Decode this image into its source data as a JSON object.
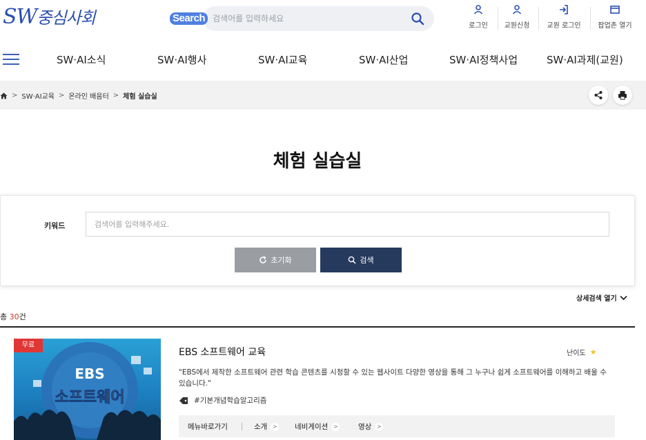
{
  "header": {
    "logo_sw": "SW",
    "logo_text": "중심사회",
    "search_tag": "Search",
    "search_placeholder": "검색어를 입력하세요",
    "utils": [
      {
        "label": "로그인",
        "icon": "person-icon"
      },
      {
        "label": "교원신청",
        "icon": "person-icon"
      },
      {
        "label": "교원 로그인",
        "icon": "login-icon"
      },
      {
        "label": "팝업존 열기",
        "icon": "window-icon"
      }
    ]
  },
  "nav": {
    "items": [
      "SW·AI소식",
      "SW·AI행사",
      "SW·AI교육",
      "SW·AI산업",
      "SW·AI정책사업",
      "SW·AI과제(교원)"
    ]
  },
  "breadcrumb": {
    "items": [
      "SW·AI교육",
      "온라인 배움터"
    ],
    "current": "체험 실습실"
  },
  "page": {
    "title": "체험 실습실"
  },
  "search_panel": {
    "keyword_label": "키워드",
    "keyword_placeholder": "검색어를 입력해주세요.",
    "reset_label": "초기화",
    "search_label": "검색",
    "detail_toggle": "상세검색 열기"
  },
  "results": {
    "total_prefix": "총 ",
    "total_count": "30",
    "total_suffix": "건"
  },
  "card": {
    "badge": "무료",
    "thumb_line1": "EBS",
    "thumb_line2": "소프트웨어",
    "title": "EBS 소프트웨어 교육",
    "difficulty_label": "난이도",
    "difficulty_stars": 1,
    "description": "\"EBS에서 제작한 소프트웨어 관련 학습 콘텐츠를 시청할 수 있는 웹사이트 다양한 영상을 통해 그 누구나 쉽게 소프트웨어를 이해하고 배울 수 있습니다.\"",
    "tag": "#기본개념학습알고리즘",
    "menu_label": "메뉴바로가기",
    "menu_items": [
      "소개",
      "네비게이션",
      "영상"
    ]
  },
  "colors": {
    "accent": "#2b4fb0",
    "search_button": "#263a5e",
    "reset_button": "#9a9da2",
    "badge": "#e03636",
    "total_count": "#c0392b"
  }
}
